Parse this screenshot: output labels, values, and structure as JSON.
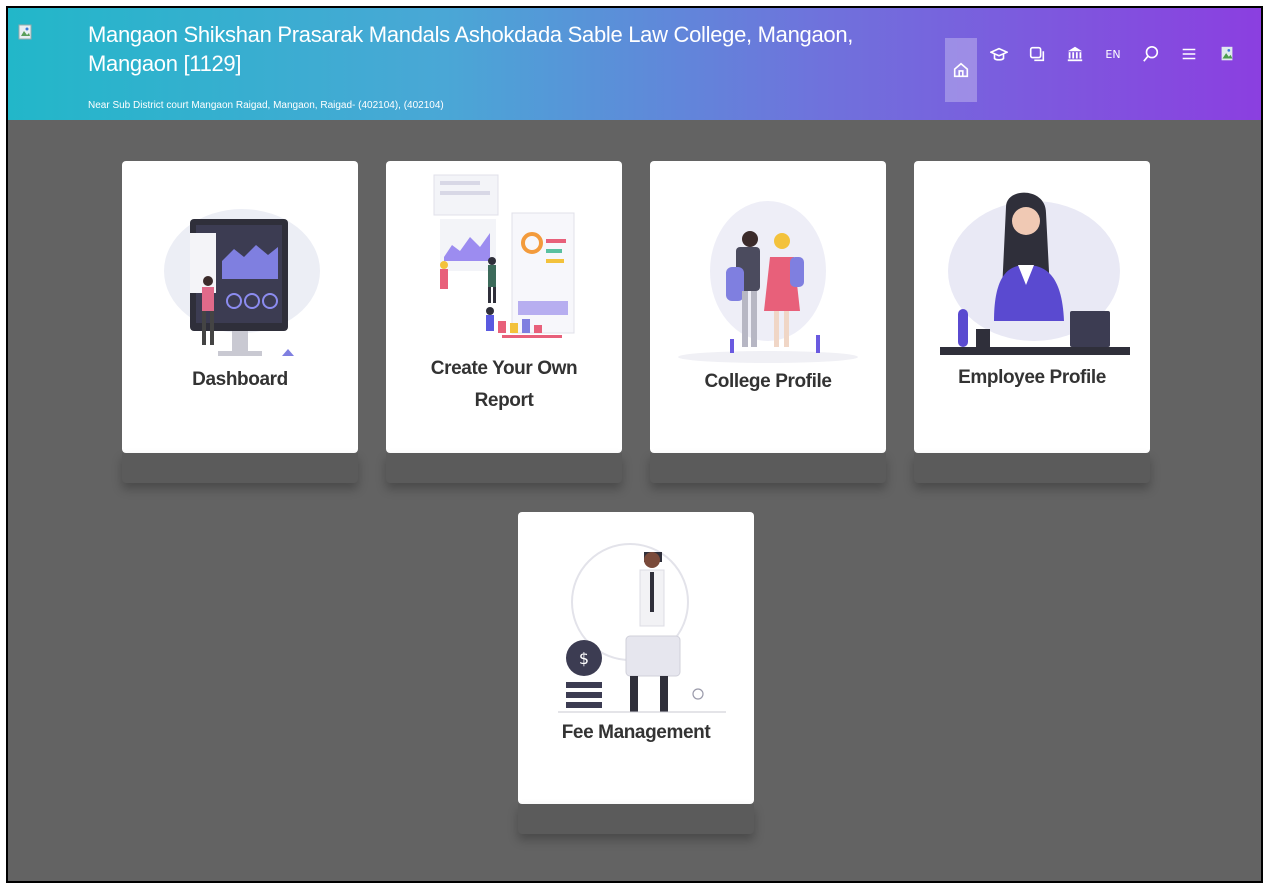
{
  "header": {
    "title": "Mangaon Shikshan Prasarak Mandals Ashokdada Sable Law College, Mangaon, Mangaon [1129]",
    "address": "Near Sub District court Mangaon Raigad, Mangaon, Raigad- (402104), (402104)",
    "language": "EN",
    "gradient_start": "#22b7c9",
    "gradient_end": "#8b3fe0",
    "icons": [
      "home-icon",
      "graduation-cap-icon",
      "copy-icon",
      "bank-icon",
      "language-icon",
      "search-icon",
      "menu-icon",
      "avatar"
    ]
  },
  "tiles": [
    {
      "id": "dashboard",
      "label": "Dashboard"
    },
    {
      "id": "report",
      "label": "Create Your Own Report"
    },
    {
      "id": "college-profile",
      "label": "College Profile"
    },
    {
      "id": "employee-profile",
      "label": "Employee Profile"
    },
    {
      "id": "fee-management",
      "label": "Fee Management"
    }
  ]
}
